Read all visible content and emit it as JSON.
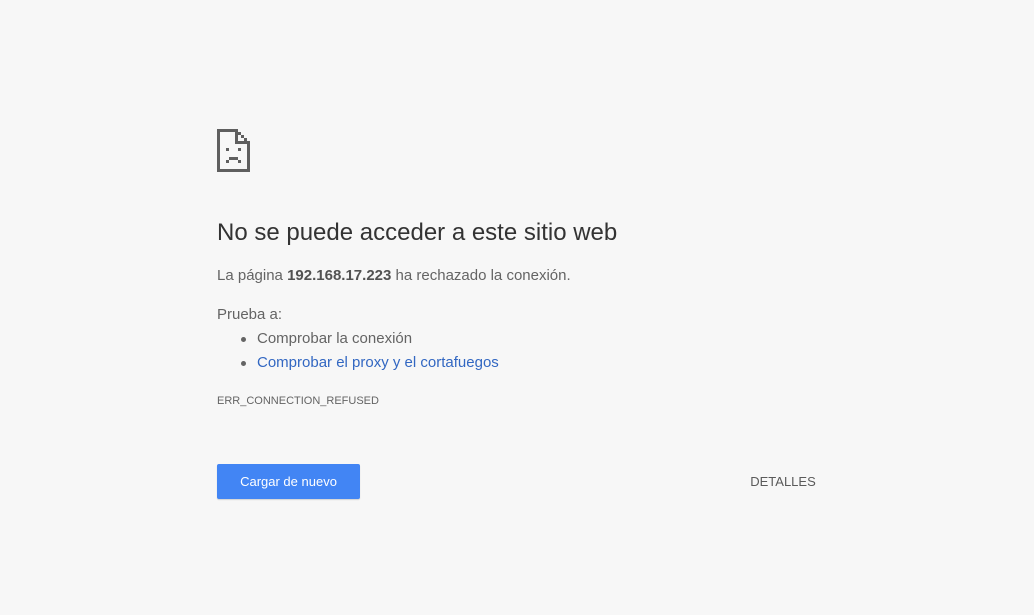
{
  "error_page": {
    "icon": "sad-page-icon",
    "title": "No se puede acceder a este sitio web",
    "description_prefix": "La página",
    "host": "192.168.17.223",
    "description_suffix": "ha rechazado la conexión.",
    "try_label": "Prueba a:",
    "suggestions": [
      {
        "text": "Comprobar la conexión",
        "is_link": false
      },
      {
        "text": "Comprobar el proxy y el cortafuegos",
        "is_link": true
      }
    ],
    "error_code": "ERR_CONNECTION_REFUSED",
    "reload_button_label": "Cargar de nuevo",
    "details_button_label": "DETALLES"
  },
  "colors": {
    "background": "#f7f7f7",
    "title": "#333333",
    "body_text": "#646464",
    "link": "#3267c2",
    "primary_button": "#4285f4"
  }
}
